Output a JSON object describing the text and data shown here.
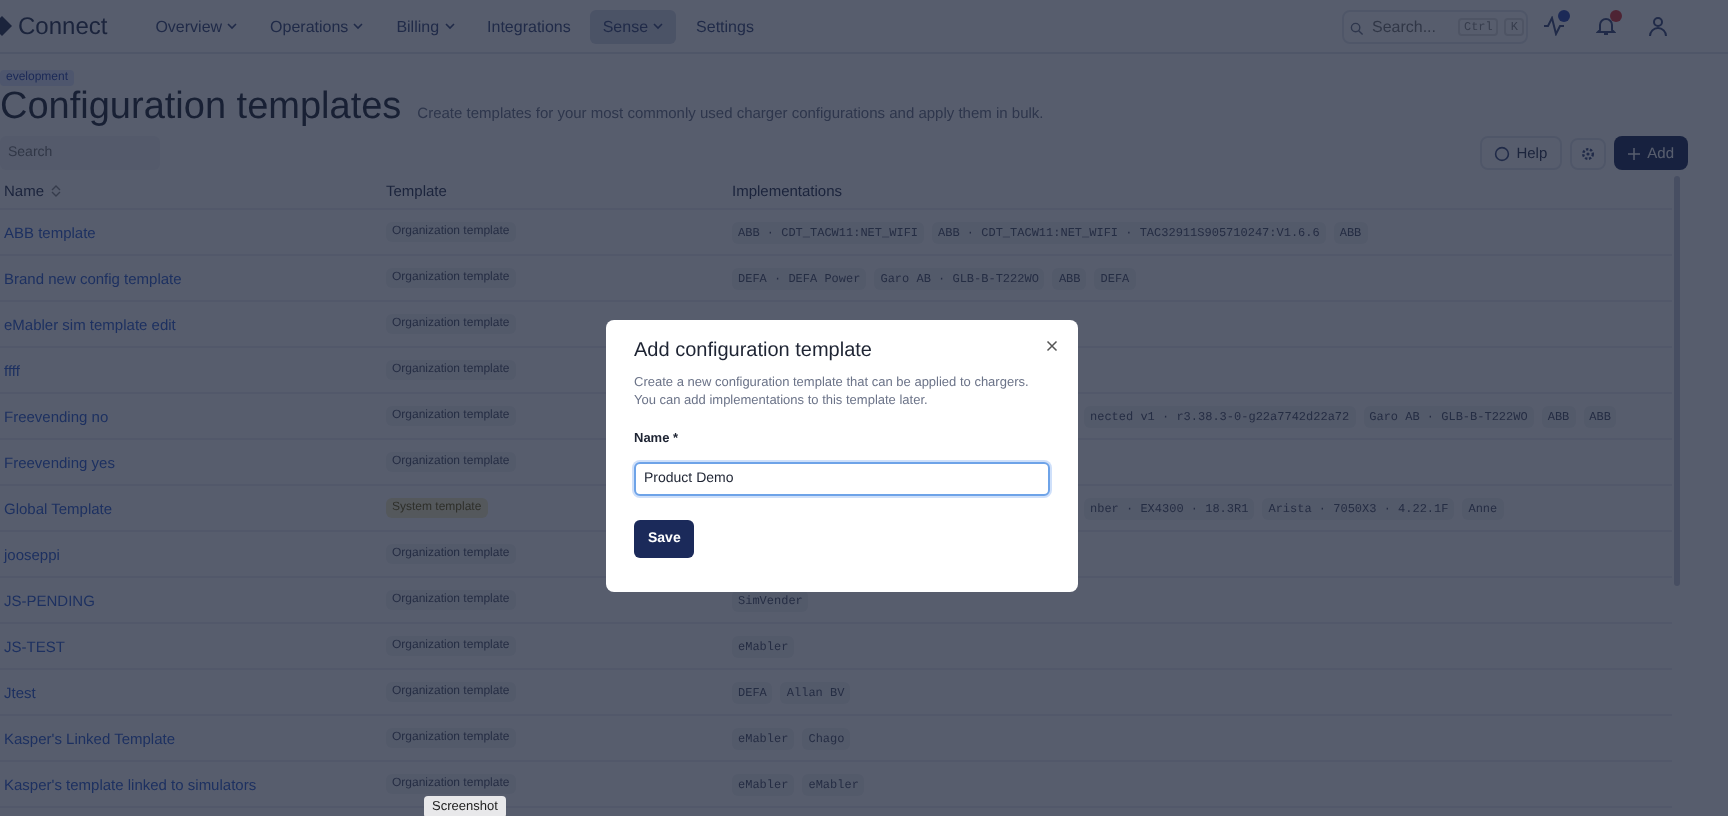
{
  "nav": {
    "logo": "Connect",
    "environment": "evelopment",
    "items": [
      {
        "label": "Overview",
        "dropdown": true,
        "selected": false
      },
      {
        "label": "Operations",
        "dropdown": true,
        "selected": false
      },
      {
        "label": "Billing",
        "dropdown": true,
        "selected": false
      },
      {
        "label": "Integrations",
        "dropdown": false,
        "selected": false
      },
      {
        "label": "Sense",
        "dropdown": true,
        "selected": true
      },
      {
        "label": "Settings",
        "dropdown": false,
        "selected": false
      }
    ],
    "search": {
      "placeholder": "Search...",
      "shortcut": [
        "Ctrl",
        "K"
      ]
    }
  },
  "page": {
    "title": "Configuration templates",
    "subtitle": "Create templates for your most commonly used charger configurations and apply them in bulk.",
    "search": {
      "placeholder": "Search"
    },
    "help": "Help",
    "add": "Add"
  },
  "table": {
    "columns": [
      "Name",
      "Template",
      "Implementations"
    ],
    "rows": [
      {
        "name": "ABB template",
        "template": {
          "label": "Organization template",
          "kind": "organization"
        },
        "implementations": [
          "ABB · CDT_TACW11:NET_WIFI",
          "ABB · CDT_TACW11:NET_WIFI · TAC32911S905710247:V1.6.6",
          "ABB"
        ]
      },
      {
        "name": "Brand new config template",
        "template": {
          "label": "Organization template",
          "kind": "organization"
        },
        "implementations": [
          "DEFA · DEFA Power",
          "Garo AB · GLB-B-T222WO",
          "ABB",
          "DEFA"
        ]
      },
      {
        "name": "eMabler sim template edit",
        "template": {
          "label": "Organization template",
          "kind": "organization"
        }
      },
      {
        "name": "ffff",
        "template": {
          "label": "Organization template",
          "kind": "organization"
        }
      },
      {
        "name": "Freevending no",
        "template": {
          "label": "Organization template",
          "kind": "organization"
        },
        "implementations": [
          "nected v1 · r3.38.3-0-g22a7742d22a72",
          "Garo AB · GLB-B-T222WO",
          "ABB",
          "ABB"
        ]
      },
      {
        "name": "Freevending yes",
        "template": {
          "label": "Organization template",
          "kind": "organization"
        }
      },
      {
        "name": "Global Template",
        "template": {
          "label": "System template",
          "kind": "system"
        },
        "implementations": [
          "nber · EX4300 · 18.3R1",
          "Arista · 7050X3 · 4.22.1F",
          "Anne"
        ]
      },
      {
        "name": "jooseppi",
        "template": {
          "label": "Organization template",
          "kind": "organization"
        }
      },
      {
        "name": "JS-PENDING",
        "template": {
          "label": "Organization template",
          "kind": "organization"
        },
        "implementations": [
          "SimVender"
        ]
      },
      {
        "name": "JS-TEST",
        "template": {
          "label": "Organization template",
          "kind": "organization"
        },
        "implementations": [
          "eMabler"
        ]
      },
      {
        "name": "Jtest",
        "template": {
          "label": "Organization template",
          "kind": "organization"
        },
        "implementations": [
          "DEFA",
          "Allan BV"
        ]
      },
      {
        "name": "Kasper's Linked Template",
        "template": {
          "label": "Organization template",
          "kind": "organization"
        },
        "implementations": [
          "eMabler",
          "Chago"
        ]
      },
      {
        "name": "Kasper's template linked to simulators",
        "template": {
          "label": "Organization template",
          "kind": "organization"
        },
        "implementations": [
          "eMabler",
          "eMabler"
        ]
      }
    ]
  },
  "tooltip": "Screenshot",
  "dialog": {
    "title": "Add configuration template",
    "description": "Create a new configuration template that can be applied to chargers. You can add implementations to this template later.",
    "field": {
      "label": "Name *",
      "value": "Product Demo"
    },
    "save": "Save"
  }
}
